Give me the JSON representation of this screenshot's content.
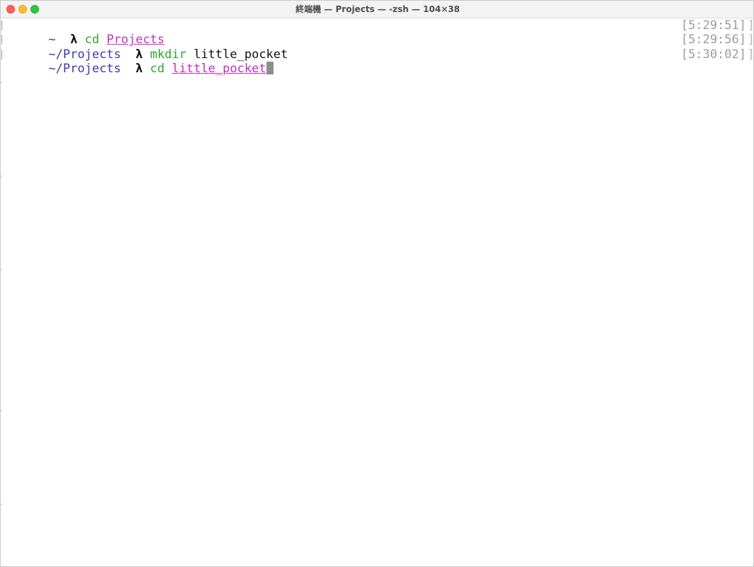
{
  "window": {
    "title": "終端機 — Projects — -zsh — 104×38"
  },
  "terminal": {
    "lines": [
      {
        "cwd": "~",
        "sep": "  ",
        "prompt": "λ",
        "command": "cd",
        "argument": "Projects",
        "argument_style": "path",
        "timestamp": "[5:29:51]"
      },
      {
        "cwd": "~/Projects",
        "sep": "  ",
        "prompt": "λ",
        "command": "mkdir",
        "argument": "little_pocket",
        "argument_style": "plain",
        "timestamp": "[5:29:56]"
      },
      {
        "cwd": "~/Projects",
        "sep": "  ",
        "prompt": "λ",
        "command": "cd",
        "argument": "little_pocket",
        "argument_style": "path",
        "timestamp": "[5:30:02]"
      }
    ],
    "right_bracket": "]",
    "colors": {
      "cwd": "#3a3aa8",
      "command": "#2fa52f",
      "path_argument": "#c42fc4",
      "timestamp": "#9b9b9b",
      "cursor": "#8e8e8e"
    }
  }
}
